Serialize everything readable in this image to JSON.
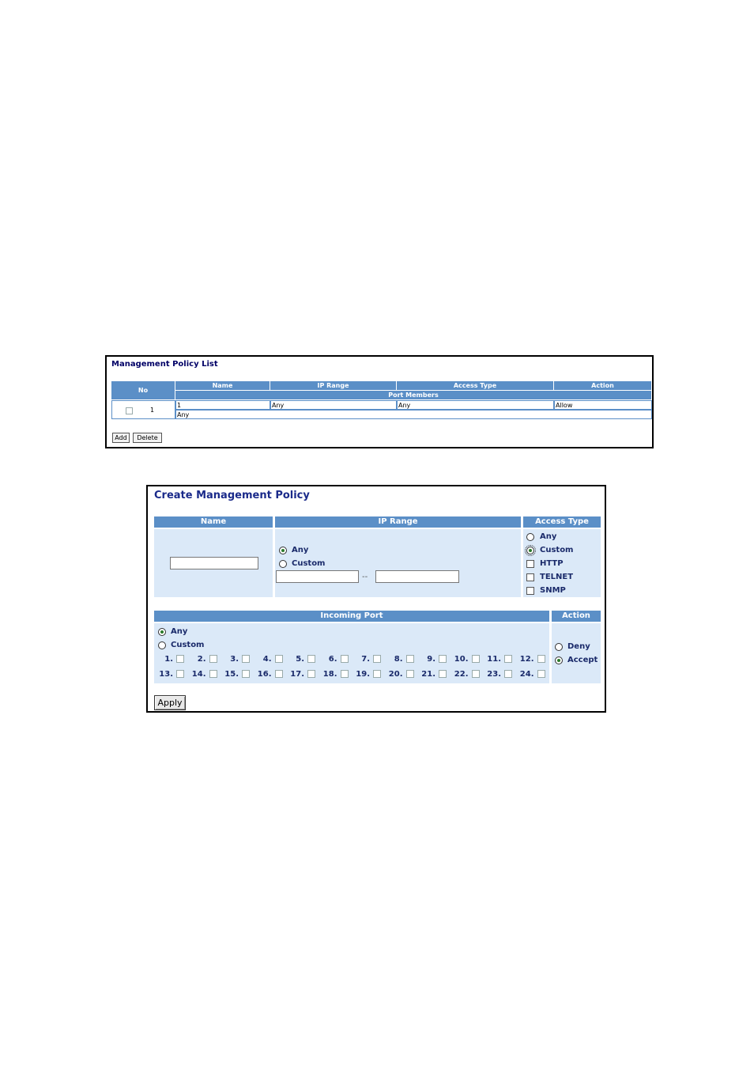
{
  "list": {
    "title": "Management Policy List",
    "headers": {
      "no": "No",
      "name": "Name",
      "ip_range": "IP Range",
      "access_type": "Access Type",
      "action": "Action",
      "port_members": "Port Members"
    },
    "row": {
      "no": "1",
      "name": "1",
      "ip_range": "Any",
      "access_type": "Any",
      "action": "Allow",
      "port_members": "Any"
    },
    "buttons": {
      "add": "Add",
      "delete": "Delete"
    }
  },
  "create": {
    "title": "Create Management Policy",
    "headers": {
      "name": "Name",
      "ip_range": "IP Range",
      "access_type": "Access Type",
      "incoming_port": "Incoming Port",
      "action": "Action"
    },
    "ip_range": {
      "options": [
        "Any",
        "Custom"
      ],
      "selected": "Any",
      "separator": "--",
      "start_value": "",
      "end_value": ""
    },
    "access_type": {
      "radios": [
        "Any",
        "Custom"
      ],
      "selected": "Custom",
      "checkboxes": [
        "HTTP",
        "TELNET",
        "SNMP"
      ]
    },
    "incoming_port": {
      "options": [
        "Any",
        "Custom"
      ],
      "selected": "Any",
      "ports": [
        "1.",
        "2.",
        "3.",
        "4.",
        "5.",
        "6.",
        "7.",
        "8.",
        "9.",
        "10.",
        "11.",
        "12.",
        "13.",
        "14.",
        "15.",
        "16.",
        "17.",
        "18.",
        "19.",
        "20.",
        "21.",
        "22.",
        "23.",
        "24."
      ]
    },
    "action": {
      "options": [
        "Deny",
        "Accept"
      ],
      "selected": "Accept"
    },
    "apply_label": "Apply"
  }
}
